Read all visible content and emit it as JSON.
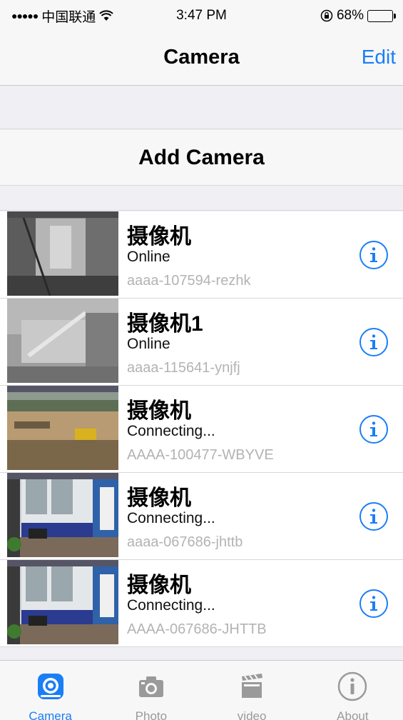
{
  "statusbar": {
    "signal": "●●●●●",
    "carrier": "中国联通",
    "time": "3:47 PM",
    "battery": "68%",
    "battery_level": 0.68
  },
  "navbar": {
    "title": "Camera",
    "edit_label": "Edit"
  },
  "add_camera_label": "Add Camera",
  "cameras": [
    {
      "name": "摄像机",
      "status": "Online",
      "id": "aaaa-107594-rezhk",
      "thumb": "gray-indoor"
    },
    {
      "name": "摄像机1",
      "status": "Online",
      "id": "aaaa-115641-ynjfj",
      "thumb": "gray-blur"
    },
    {
      "name": "摄像机",
      "status": "Connecting...",
      "id": "AAAA-100477-WBYVE",
      "thumb": "construction-site"
    },
    {
      "name": "摄像机",
      "status": "Connecting...",
      "id": "aaaa-067686-jhttb",
      "thumb": "office-room"
    },
    {
      "name": "摄像机",
      "status": "Connecting...",
      "id": "AAAA-067686-JHTTB",
      "thumb": "office-room"
    }
  ],
  "tabs": [
    {
      "label": "Camera",
      "icon": "camera-lens-icon",
      "active": true
    },
    {
      "label": "Photo",
      "icon": "photo-camera-icon",
      "active": false
    },
    {
      "label": "video",
      "icon": "clapperboard-icon",
      "active": false
    },
    {
      "label": "About",
      "icon": "info-icon",
      "active": false
    }
  ],
  "colors": {
    "accent": "#1a7ef7",
    "inactive_tab": "#9a9a9a",
    "secondary_text": "#b3b3b3"
  }
}
